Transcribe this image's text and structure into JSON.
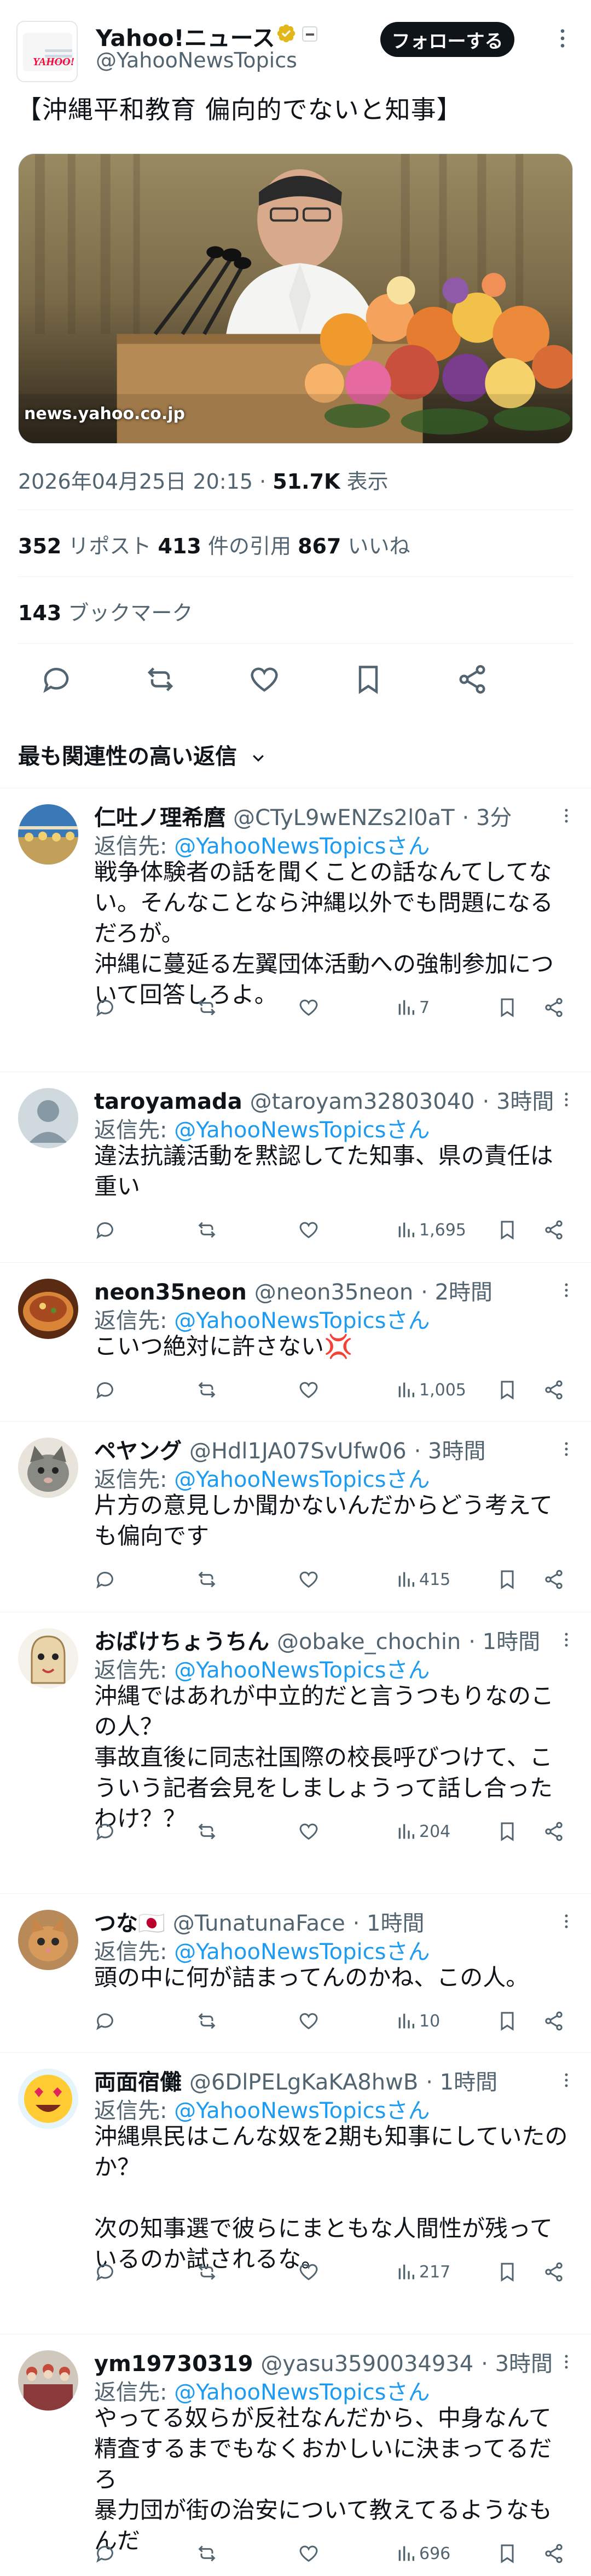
{
  "account": {
    "name": "Yahoo!ニュース",
    "handle": "@YahooNewsTopics",
    "follow_label": "フォローする"
  },
  "post": {
    "text": "【沖縄平和教育 偏向的でないと知事】",
    "media_caption": "news.yahoo.co.jp",
    "timestamp": "2026年04月25日 20:15",
    "views": "51.7K",
    "views_label": "表示",
    "reposts": "352",
    "reposts_label": "リポスト",
    "quotes": "413",
    "quotes_label": "件の引用",
    "likes": "867",
    "likes_label": "いいね",
    "bookmarks": "143",
    "bookmarks_label": "ブックマーク"
  },
  "sort_label": "最も関連性の高い返信",
  "replies": [
    {
      "name": "仁吐ノ理希麿",
      "handle": "@CTyL9wENZs2l0aT",
      "time": "· 3分",
      "reply_to_prefix": "返信先: ",
      "reply_to": "@YahooNewsTopicsさん",
      "text": "戦争体験者の話を聞くことの話なんてしてない。そんなことなら沖縄以外でも問題になるだろが。\n沖縄に蔓延る左翼団体活動への強制参加について回答しろよ。",
      "views": "7"
    },
    {
      "name": "taroyamada",
      "handle": "@taroyam32803040",
      "time": "· 3時間",
      "reply_to_prefix": "返信先: ",
      "reply_to": "@YahooNewsTopicsさん",
      "text": "違法抗議活動を黙認してた知事、県の責任は重い",
      "views": "1,695"
    },
    {
      "name": "neon35neon",
      "handle": "@neon35neon",
      "time": "· 2時間",
      "reply_to_prefix": "返信先: ",
      "reply_to": "@YahooNewsTopicsさん",
      "text": "こいつ絶対に許さない💢",
      "views": "1,005"
    },
    {
      "name": "ペヤング",
      "handle": "@Hdl1JA07SvUfw06",
      "time": "· 3時間",
      "reply_to_prefix": "返信先: ",
      "reply_to": "@YahooNewsTopicsさん",
      "text": "片方の意見しか聞かないんだからどう考えても偏向です",
      "views": "415"
    },
    {
      "name": "おばけちょうちん",
      "handle": "@obake_chochin",
      "time": "· 1時間",
      "reply_to_prefix": "返信先: ",
      "reply_to": "@YahooNewsTopicsさん",
      "text": "沖縄ではあれが中立的だと言うつもりなのこの人？\n事故直後に同志社国際の校長呼びつけて、こういう記者会見をしましょうって話し合ったわけ？？",
      "views": "204"
    },
    {
      "name": "つな🇯🇵",
      "handle": "@TunatunaFace",
      "time": "· 1時間",
      "reply_to_prefix": "返信先: ",
      "reply_to": "@YahooNewsTopicsさん",
      "text": "頭の中に何が詰まってんのかね、この人。",
      "views": "10"
    },
    {
      "name": "両面宿儺",
      "handle": "@6DlPELgKaKA8hwB",
      "time": "· 1時間",
      "reply_to_prefix": "返信先: ",
      "reply_to": "@YahooNewsTopicsさん",
      "text": "沖縄県民はこんな奴を2期も知事にしていたのか？\n\n次の知事選で彼らにまともな人間性が残っているのか試されるな。",
      "views": "217"
    },
    {
      "name": "ym19730319",
      "handle": "@yasu3590034934",
      "time": "· 3時間",
      "reply_to_prefix": "返信先: ",
      "reply_to": "@YahooNewsTopicsさん",
      "text": "やってる奴らが反社なんだから、中身なんて精査するまでもなくおかしいに決まってるだろ\n暴力団が街の治安について教えてるようなもんだ",
      "views": "696"
    }
  ]
}
